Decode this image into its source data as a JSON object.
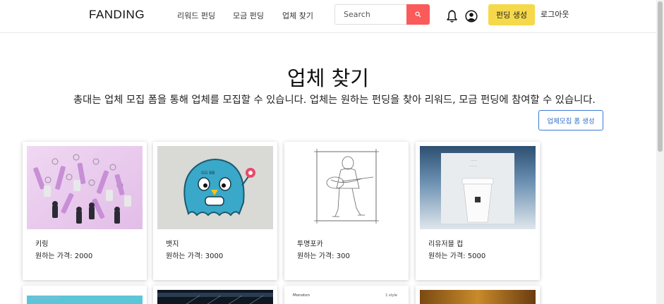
{
  "navbar": {
    "brand": "FANDING",
    "links": [
      "리워드 펀딩",
      "모금 펀딩",
      "업체 찾기"
    ],
    "search_placeholder": "Search",
    "create_label": "펀딩 생성",
    "logout_label": "로그아웃"
  },
  "hero": {
    "title": "업체 찾기",
    "subtitle": "총대는 업체 모집 폼을 통해 업체를 모집할 수 있습니다. 업체는 원하는 펀딩을 찾아 리워드, 모금 펀딩에 참여할 수 있습니다.",
    "form_button": "업체모집 폼 생성"
  },
  "price_label": "원하는 가격:",
  "cards": [
    {
      "name": "키링",
      "price": "2000"
    },
    {
      "name": "뱃지",
      "price": "3000"
    },
    {
      "name": "투명포카",
      "price": "300"
    },
    {
      "name": "리유저블 컵",
      "price": "5000"
    }
  ],
  "bottom_cards": {
    "font_title": "Monoton",
    "font_style": "1 style"
  },
  "colors": {
    "search_button": "#fa5a5a",
    "create_button": "#f5d94a",
    "form_button_border": "#3a7bd5"
  },
  "icons": {
    "search": "magnifier-icon",
    "bell": "bell-icon",
    "user": "user-circle-icon"
  }
}
